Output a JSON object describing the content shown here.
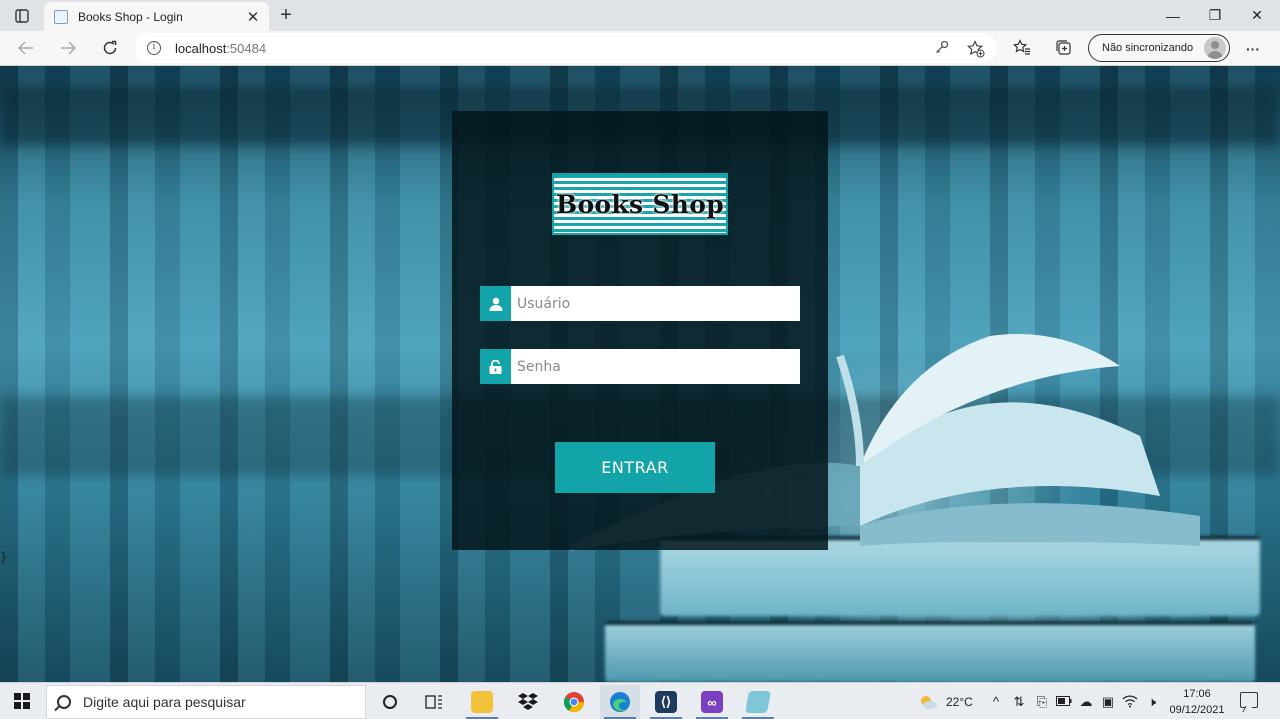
{
  "browser": {
    "tab_title": "Books Shop - Login",
    "tab_close": "✕",
    "new_tab": "+",
    "url_host": "localhost",
    "url_port": ":50484",
    "profile_label": "Não sincronizando",
    "window_controls": {
      "minimize": "—",
      "maximize": "❐",
      "close": "✕"
    },
    "more_menu": "···"
  },
  "page": {
    "stray_text": "}",
    "logo_text": "Books Shop",
    "username_placeholder": "Usuário",
    "password_placeholder": "Senha",
    "submit_label": "ENTRAR",
    "accent_color": "#12a4a9"
  },
  "taskbar": {
    "search_placeholder": "Digite aqui para pesquisar",
    "weather_temp": "22°C",
    "time": "17:06",
    "date": "09/12/2021",
    "apps": [
      "task-view",
      "file-explorer",
      "dropbox",
      "chrome",
      "edge",
      "visual-studio-code",
      "visual-studio",
      "notepad"
    ]
  }
}
